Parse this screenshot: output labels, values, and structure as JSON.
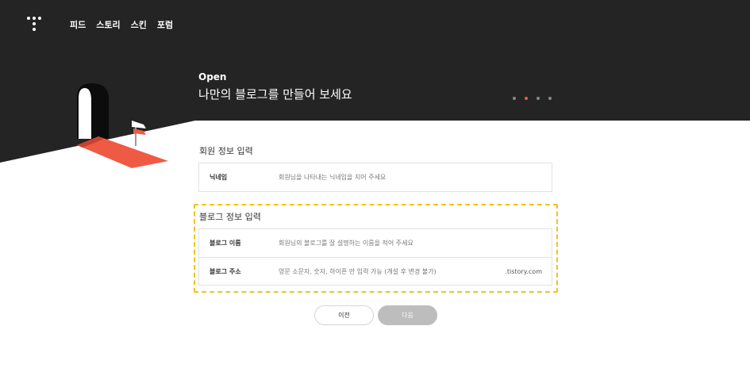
{
  "colors": {
    "header_bg": "#242424",
    "accent": "#ef5a45",
    "highlight_border": "#f0c419",
    "button_disabled": "#bdbdbd"
  },
  "header": {
    "logo_icon": "tistory-logo-icon",
    "nav": [
      {
        "label": "피드"
      },
      {
        "label": "스토리"
      },
      {
        "label": "스킨"
      },
      {
        "label": "포럼"
      }
    ]
  },
  "hero": {
    "subtitle": "Open",
    "title": "나만의 블로그를 만들어 보세요",
    "steps_total": 4,
    "steps_active": 2,
    "illustration_icon": "door-signpost-illustration"
  },
  "member_section": {
    "title": "회원 정보 입력",
    "nickname": {
      "label": "닉네임",
      "placeholder": "회원님을 나타내는 닉네임을 지어 주세요",
      "value": ""
    }
  },
  "blog_section": {
    "title": "블로그 정보 입력",
    "name": {
      "label": "블로그 이름",
      "placeholder": "회원님의 블로그를 잘 설명하는 이름을 적어 주세요",
      "value": ""
    },
    "address": {
      "label": "블로그 주소",
      "placeholder": "영문 소문자, 숫자, 하이픈 만 입력 가능 (개설 후 변경 불가)",
      "value": "",
      "suffix": ".tistory.com"
    }
  },
  "buttons": {
    "prev_label": "이전",
    "next_label": "다음"
  }
}
